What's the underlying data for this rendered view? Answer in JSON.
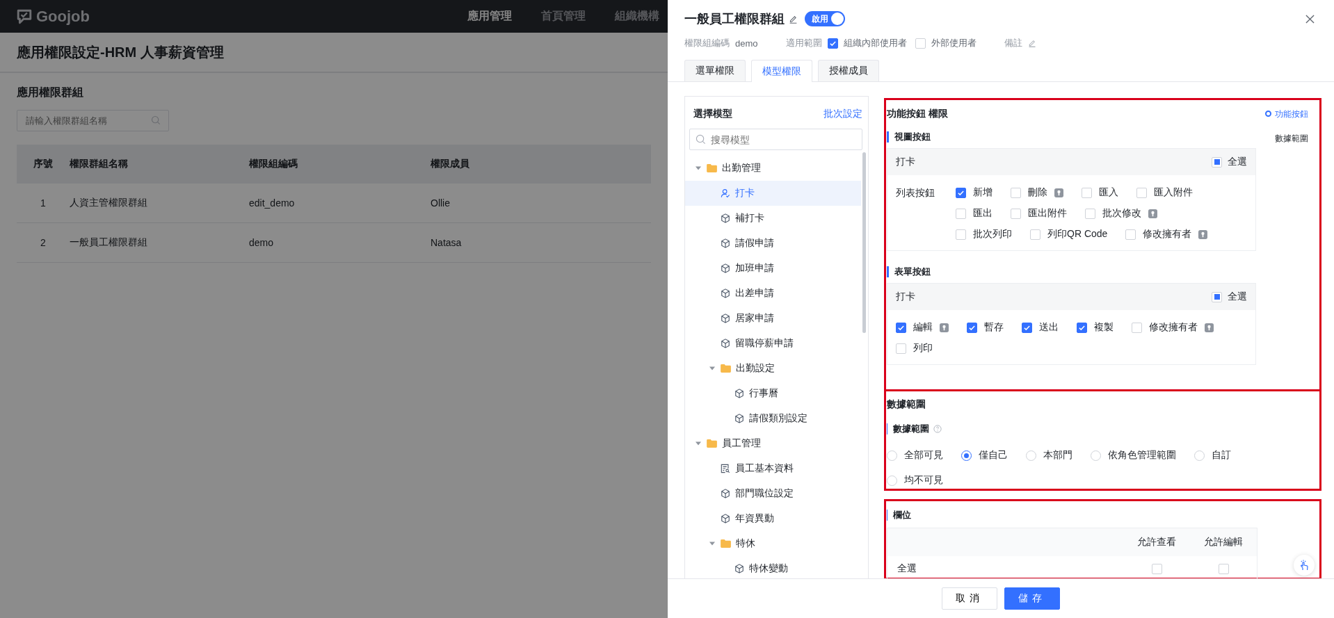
{
  "header": {
    "logo": "Goojob",
    "nav": [
      {
        "label": "應用管理",
        "selected": true
      },
      {
        "label": "首頁管理",
        "selected": false
      },
      {
        "label": "組織機構",
        "selected": false
      }
    ]
  },
  "page": {
    "title": "應用權限設定-HRM 人事薪資管理",
    "section_title": "應用權限群組",
    "search": {
      "placeholder": "請輸入權限群組名稱"
    },
    "table": {
      "columns": [
        "序號",
        "權限群組名稱",
        "權限組編碼",
        "權限成員"
      ],
      "rows": [
        [
          "1",
          "人資主管權限群組",
          "edit_demo",
          "Ollie"
        ],
        [
          "2",
          "一般員工權限群組",
          "demo",
          "Natasa"
        ]
      ]
    }
  },
  "drawer": {
    "title": "一般員工權限群組",
    "status": {
      "label": "啟用",
      "on": true
    },
    "meta": {
      "code_label": "權限組編碼",
      "code": "demo",
      "scope_label": "適用範圍",
      "scopes": [
        {
          "label": "組織內部使用者",
          "checked": true
        },
        {
          "label": "外部使用者",
          "checked": false
        }
      ],
      "note_label": "備註"
    },
    "tabs": [
      {
        "label": "選單權限",
        "selected": false
      },
      {
        "label": "模型權限",
        "selected": true
      },
      {
        "label": "授權成員",
        "selected": false
      }
    ],
    "model_panel": {
      "title": "選擇模型",
      "batch_link": "批次設定",
      "search": {
        "placeholder": "搜尋模型"
      },
      "tree": [
        {
          "label": "出勤管理",
          "kind": "folder",
          "expanded": true,
          "selected": false,
          "children": [
            {
              "label": "打卡",
              "kind": "user",
              "selected": true
            },
            {
              "label": "補打卡",
              "kind": "model",
              "selected": false
            },
            {
              "label": "請假申請",
              "kind": "model",
              "selected": false
            },
            {
              "label": "加班申請",
              "kind": "model",
              "selected": false
            },
            {
              "label": "出差申請",
              "kind": "model",
              "selected": false
            },
            {
              "label": "居家申請",
              "kind": "model",
              "selected": false
            },
            {
              "label": "留職停薪申請",
              "kind": "model",
              "selected": false
            },
            {
              "label": "出勤設定",
              "kind": "folder",
              "expanded": true,
              "selected": false,
              "children": [
                {
                  "label": "行事曆",
                  "kind": "model",
                  "selected": false
                },
                {
                  "label": "請假類別設定",
                  "kind": "model",
                  "selected": false
                }
              ]
            }
          ]
        },
        {
          "label": "員工管理",
          "kind": "folder",
          "expanded": true,
          "selected": false,
          "children": [
            {
              "label": "員工基本資料",
              "kind": "form",
              "selected": false
            },
            {
              "label": "部門職位設定",
              "kind": "model",
              "selected": false
            },
            {
              "label": "年資異動",
              "kind": "model",
              "selected": false
            },
            {
              "label": "特休",
              "kind": "folder",
              "expanded": true,
              "selected": false,
              "children": [
                {
                  "label": "特休變動",
                  "kind": "model",
                  "selected": false
                }
              ]
            }
          ]
        }
      ]
    },
    "function_section": {
      "title": "功能按鈕 權限",
      "groups": [
        {
          "heading": "視圖按鈕",
          "card_title": "打卡",
          "select_all": {
            "label": "全選",
            "checked": false,
            "indeterminate": true
          },
          "row_label": "列表按鈕",
          "lines": [
            {
              "buttons": [
                {
                  "label": "新增",
                  "checked": true,
                  "locked": false
                },
                {
                  "label": "刪除",
                  "checked": false,
                  "locked": true
                },
                {
                  "label": "匯入",
                  "checked": false,
                  "locked": false
                },
                {
                  "label": "匯入附件",
                  "checked": false,
                  "locked": false
                }
              ]
            },
            {
              "buttons": [
                {
                  "label": "匯出",
                  "checked": false,
                  "locked": false
                },
                {
                  "label": "匯出附件",
                  "checked": false,
                  "locked": false
                },
                {
                  "label": "批次修改",
                  "checked": false,
                  "locked": true
                }
              ]
            },
            {
              "buttons": [
                {
                  "label": "批次列印",
                  "checked": false,
                  "locked": false
                },
                {
                  "label": "列印QR Code",
                  "checked": false,
                  "locked": false
                },
                {
                  "label": "修改擁有者",
                  "checked": false,
                  "locked": true
                }
              ]
            }
          ]
        },
        {
          "heading": "表單按鈕",
          "card_title": "打卡",
          "select_all": {
            "label": "全選",
            "checked": false,
            "indeterminate": true
          },
          "lines": [
            {
              "buttons": [
                {
                  "label": "編輯",
                  "checked": true,
                  "locked": true
                },
                {
                  "label": "暫存",
                  "checked": true,
                  "locked": false
                },
                {
                  "label": "送出",
                  "checked": true,
                  "locked": false
                },
                {
                  "label": "複製",
                  "checked": true,
                  "locked": false
                },
                {
                  "label": "修改擁有者",
                  "checked": false,
                  "locked": true
                }
              ]
            },
            {
              "buttons": [
                {
                  "label": "列印",
                  "checked": false,
                  "locked": false
                }
              ]
            }
          ]
        }
      ]
    },
    "anchors": [
      {
        "label": "功能按鈕",
        "selected": true
      },
      {
        "label": "數據範圍",
        "selected": false
      }
    ],
    "data_scope": {
      "title": "數據範圍",
      "label": "數據範圍",
      "lines": [
        {
          "options": [
            {
              "label": "全部可見",
              "selected": false
            },
            {
              "label": "僅自己",
              "selected": true
            },
            {
              "label": "本部門",
              "selected": false
            },
            {
              "label": "依角色管理範圍",
              "selected": false
            },
            {
              "label": "自訂",
              "selected": false
            }
          ]
        },
        {
          "options": [
            {
              "label": "均不可見",
              "selected": false
            }
          ]
        }
      ]
    },
    "fields": {
      "title": "欄位",
      "columns": [
        "允許查看",
        "允許編輯"
      ],
      "rows": [
        {
          "label": "全選",
          "view": false,
          "edit": false
        }
      ]
    },
    "footer": {
      "cancel": "取消",
      "save": "儲存"
    }
  }
}
